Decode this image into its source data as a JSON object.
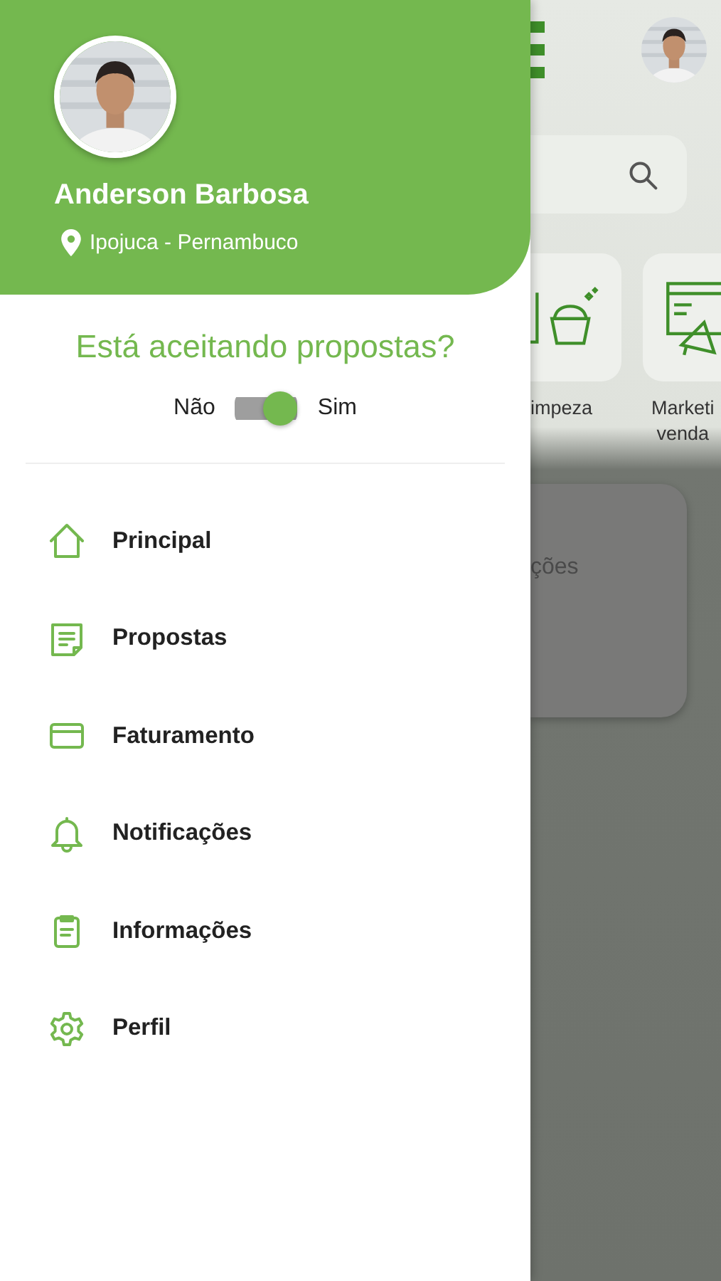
{
  "drawer": {
    "profile": {
      "name": "Anderson Barbosa",
      "location": "Ipojuca - Pernambuco"
    },
    "question": "Está aceitando propostas?",
    "toggle": {
      "off_label": "Não",
      "on_label": "Sim",
      "on": true
    },
    "menu": [
      {
        "kind": "home",
        "label": "Principal"
      },
      {
        "kind": "document",
        "label": "Propostas"
      },
      {
        "kind": "card",
        "label": "Faturamento"
      },
      {
        "kind": "bell",
        "label": "Notificações"
      },
      {
        "kind": "clipboard",
        "label": "Informações"
      },
      {
        "kind": "gear",
        "label": "Perfil"
      }
    ]
  },
  "background": {
    "categories": [
      {
        "kind": "cleaning",
        "label": "impeza"
      },
      {
        "kind": "seo",
        "label": "Marketi\nvenda"
      }
    ],
    "card_text": "ções"
  }
}
